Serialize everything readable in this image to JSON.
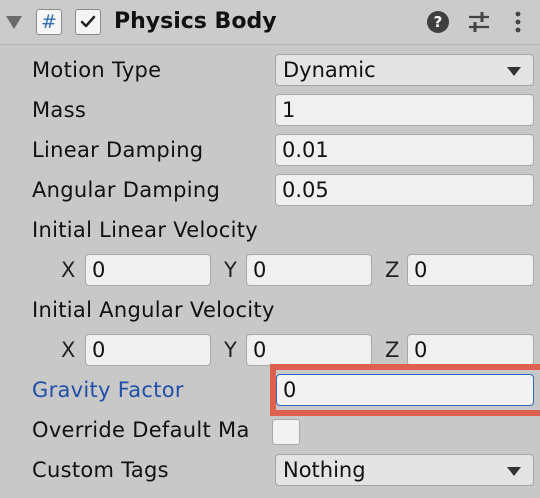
{
  "component": {
    "title": "Physics Body",
    "script_icon_glyph": "#",
    "enabled": true,
    "help_glyph": "?",
    "icons": [
      "fold-triangle-icon",
      "script-icon",
      "checkbox-checked-icon",
      "help-icon",
      "presets-icon",
      "kebab-menu-icon"
    ]
  },
  "fields": {
    "motion_type": {
      "label": "Motion Type",
      "value": "Dynamic"
    },
    "mass": {
      "label": "Mass",
      "value": "1"
    },
    "linear_damping": {
      "label": "Linear Damping",
      "value": "0.01"
    },
    "angular_damping": {
      "label": "Angular Damping",
      "value": "0.05"
    },
    "initial_linear_velocity": {
      "label": "Initial Linear Velocity",
      "x_label": "X",
      "x": "0",
      "y_label": "Y",
      "y": "0",
      "z_label": "Z",
      "z": "0"
    },
    "initial_angular_velocity": {
      "label": "Initial Angular Velocity",
      "x_label": "X",
      "x": "0",
      "y_label": "Y",
      "y": "0",
      "z_label": "Z",
      "z": "0"
    },
    "gravity_factor": {
      "label": "Gravity Factor",
      "value": "0"
    },
    "override_default_mass": {
      "label": "Override Default Ma",
      "checked": false
    },
    "custom_tags": {
      "label": "Custom Tags",
      "value": "Nothing"
    }
  },
  "colors": {
    "highlight": "#e0604f",
    "modified_label": "#1f4fa8",
    "panel_bg": "#c8c8c8"
  }
}
